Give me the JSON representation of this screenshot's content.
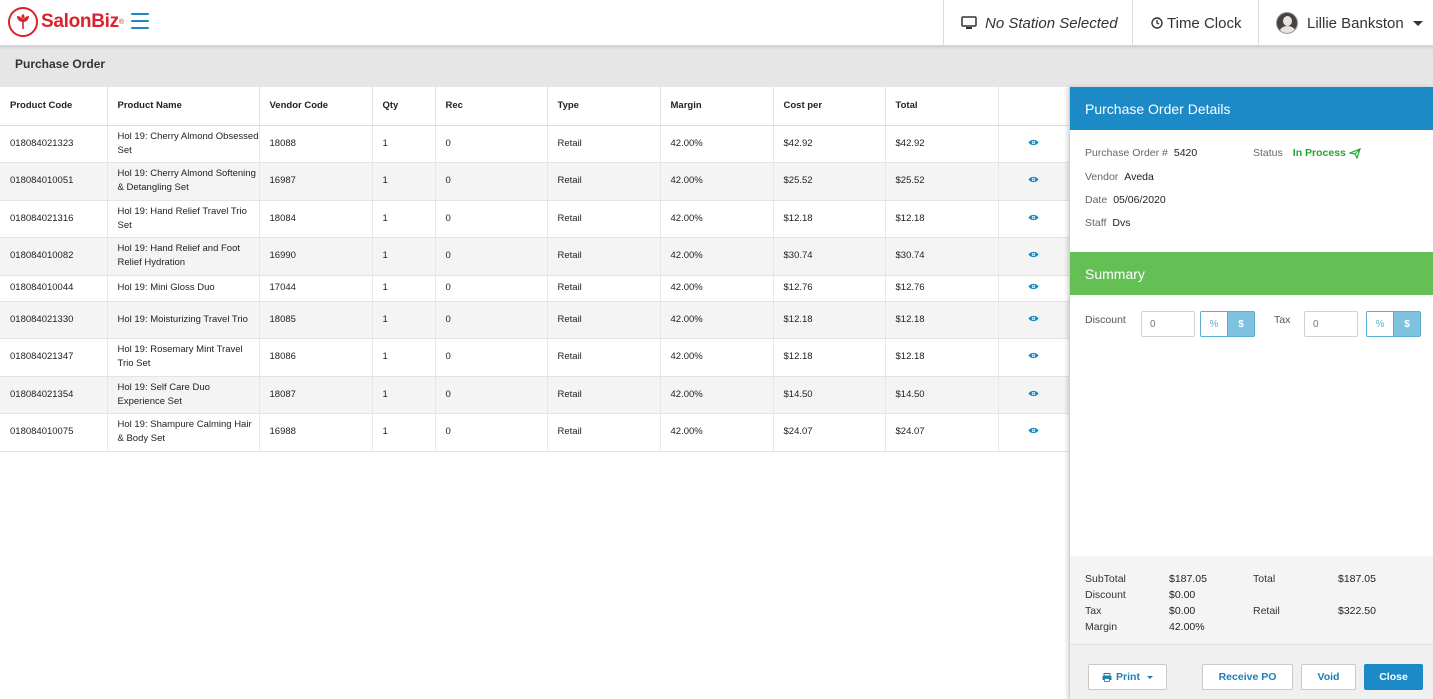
{
  "app": {
    "logo_text": "SalonBiz",
    "logo_reg": "®",
    "station": "No Station Selected",
    "time_clock": "Time Clock",
    "user_name": "Lillie Bankston",
    "brand_red": "#d9232d",
    "accent_blue": "#1b8ac7"
  },
  "page": {
    "title": "Purchase Order"
  },
  "table": {
    "columns": [
      "Product Code",
      "Product Name",
      "Vendor Code",
      "Qty",
      "Rec",
      "Type",
      "Margin",
      "Cost per",
      "Total",
      ""
    ],
    "rows": [
      {
        "code": "018084021323",
        "name": "Hol 19: Cherry Almond Obsessed Set",
        "vendor": "18088",
        "qty": "1",
        "rec": "0",
        "type": "Retail",
        "margin": "42.00%",
        "cost": "$42.92",
        "total": "$42.92"
      },
      {
        "code": "018084010051",
        "name": "Hol 19: Cherry Almond Softening & Detangling Set",
        "vendor": "16987",
        "qty": "1",
        "rec": "0",
        "type": "Retail",
        "margin": "42.00%",
        "cost": "$25.52",
        "total": "$25.52"
      },
      {
        "code": "018084021316",
        "name": "Hol 19: Hand Relief Travel Trio Set",
        "vendor": "18084",
        "qty": "1",
        "rec": "0",
        "type": "Retail",
        "margin": "42.00%",
        "cost": "$12.18",
        "total": "$12.18"
      },
      {
        "code": "018084010082",
        "name": "Hol 19: Hand Relief and Foot Relief Hydration",
        "vendor": "16990",
        "qty": "1",
        "rec": "0",
        "type": "Retail",
        "margin": "42.00%",
        "cost": "$30.74",
        "total": "$30.74"
      },
      {
        "code": "018084010044",
        "name": "Hol 19: Mini Gloss Duo",
        "vendor": "17044",
        "qty": "1",
        "rec": "0",
        "type": "Retail",
        "margin": "42.00%",
        "cost": "$12.76",
        "total": "$12.76"
      },
      {
        "code": "018084021330",
        "name": "Hol 19: Moisturizing Travel Trio",
        "vendor": "18085",
        "qty": "1",
        "rec": "0",
        "type": "Retail",
        "margin": "42.00%",
        "cost": "$12.18",
        "total": "$12.18"
      },
      {
        "code": "018084021347",
        "name": "Hol 19: Rosemary Mint Travel Trio Set",
        "vendor": "18086",
        "qty": "1",
        "rec": "0",
        "type": "Retail",
        "margin": "42.00%",
        "cost": "$12.18",
        "total": "$12.18"
      },
      {
        "code": "018084021354",
        "name": "Hol 19: Self Care Duo Experience Set",
        "vendor": "18087",
        "qty": "1",
        "rec": "0",
        "type": "Retail",
        "margin": "42.00%",
        "cost": "$14.50",
        "total": "$14.50"
      },
      {
        "code": "018084010075",
        "name": "Hol 19: Shampure Calming Hair & Body Set",
        "vendor": "16988",
        "qty": "1",
        "rec": "0",
        "type": "Retail",
        "margin": "42.00%",
        "cost": "$24.07",
        "total": "$24.07"
      }
    ]
  },
  "panel": {
    "title": "Purchase Order Details",
    "po_label": "Purchase Order #",
    "po_number": "5420",
    "status_label": "Status",
    "status_value": "In Process",
    "vendor_label": "Vendor",
    "vendor_value": "Aveda",
    "date_label": "Date",
    "date_value": "05/06/2020",
    "staff_label": "Staff",
    "staff_value": "Dvs",
    "summary_title": "Summary",
    "discount_label": "Discount",
    "discount_placeholder": "0",
    "tax_label": "Tax",
    "tax_placeholder": "0",
    "pct_label": "%",
    "usd_label": "$",
    "subtotal_label": "SubTotal",
    "subtotal_value": "$187.05",
    "discount_total_label": "Discount",
    "discount_total_value": "$0.00",
    "tax_total_label": "Tax",
    "tax_total_value": "$0.00",
    "margin_label": "Margin",
    "margin_value": "42.00%",
    "total_label": "Total",
    "total_value": "$187.05",
    "retail_label": "Retail",
    "retail_value": "$322.50",
    "status_color": "#1fa62e",
    "summary_color": "#64bf54"
  },
  "footer": {
    "print": "Print",
    "receive": "Receive PO",
    "void": "Void",
    "close": "Close"
  }
}
